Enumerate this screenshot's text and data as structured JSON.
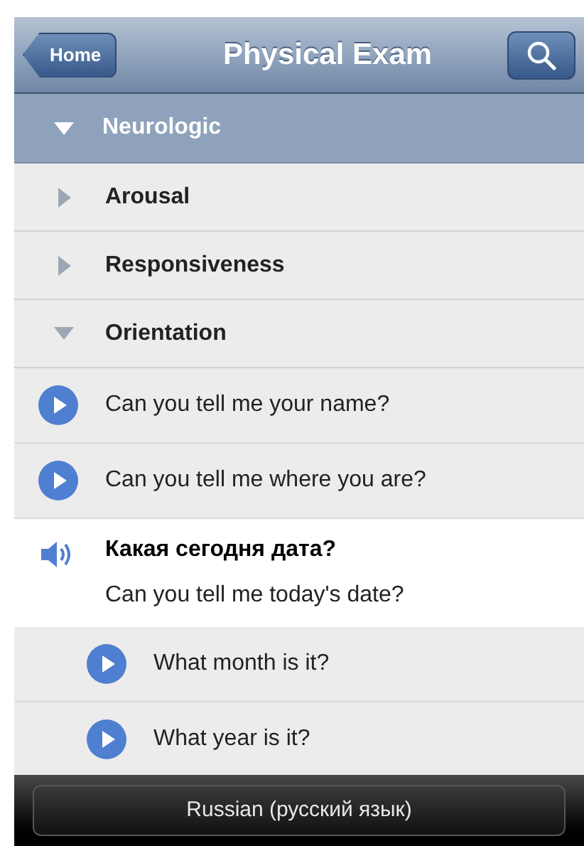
{
  "nav": {
    "back": "Home",
    "title": "Physical Exam"
  },
  "section": {
    "label": "Neurologic",
    "expanded": true
  },
  "items": [
    {
      "kind": "category",
      "label": "Arousal",
      "expanded": false
    },
    {
      "kind": "category",
      "label": "Responsiveness",
      "expanded": false
    },
    {
      "kind": "category",
      "label": "Orientation",
      "expanded": true
    },
    {
      "kind": "phrase",
      "text": "Can you tell me your name?",
      "playing": false
    },
    {
      "kind": "phrase",
      "text": "Can you tell me where you are?",
      "playing": false
    },
    {
      "kind": "phrase",
      "translation": "Какая сегодня дата?",
      "text": "Can you tell me today's date?",
      "playing": true,
      "children": [
        {
          "kind": "phrase",
          "text": "What month is it?",
          "playing": false
        },
        {
          "kind": "phrase",
          "text": "What year is it?",
          "playing": false
        }
      ]
    }
  ],
  "language_button": "Russian (русский язык)"
}
